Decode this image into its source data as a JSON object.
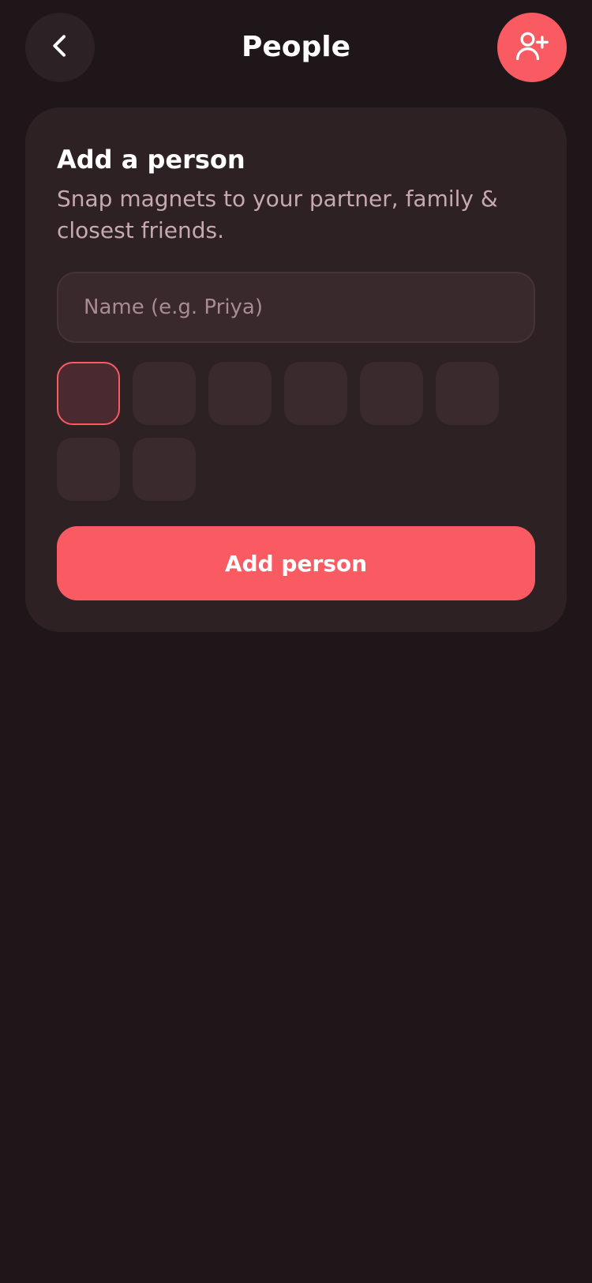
{
  "header": {
    "title": "People",
    "back_icon": "chevron-left-icon",
    "add_icon": "user-plus-icon"
  },
  "card": {
    "title": "Add a person",
    "subtitle": "Snap magnets to your partner, family & closest friends.",
    "name_placeholder": "Name (e.g. Priya)",
    "name_value": "",
    "swatches": [
      {
        "selected": true
      },
      {
        "selected": false
      },
      {
        "selected": false
      },
      {
        "selected": false
      },
      {
        "selected": false
      },
      {
        "selected": false
      },
      {
        "selected": false
      },
      {
        "selected": false
      }
    ],
    "submit_label": "Add person"
  },
  "colors": {
    "background": "#1f161a",
    "card": "#2d2124",
    "accent": "#fa5a62",
    "muted_text": "#c7a9ae"
  }
}
